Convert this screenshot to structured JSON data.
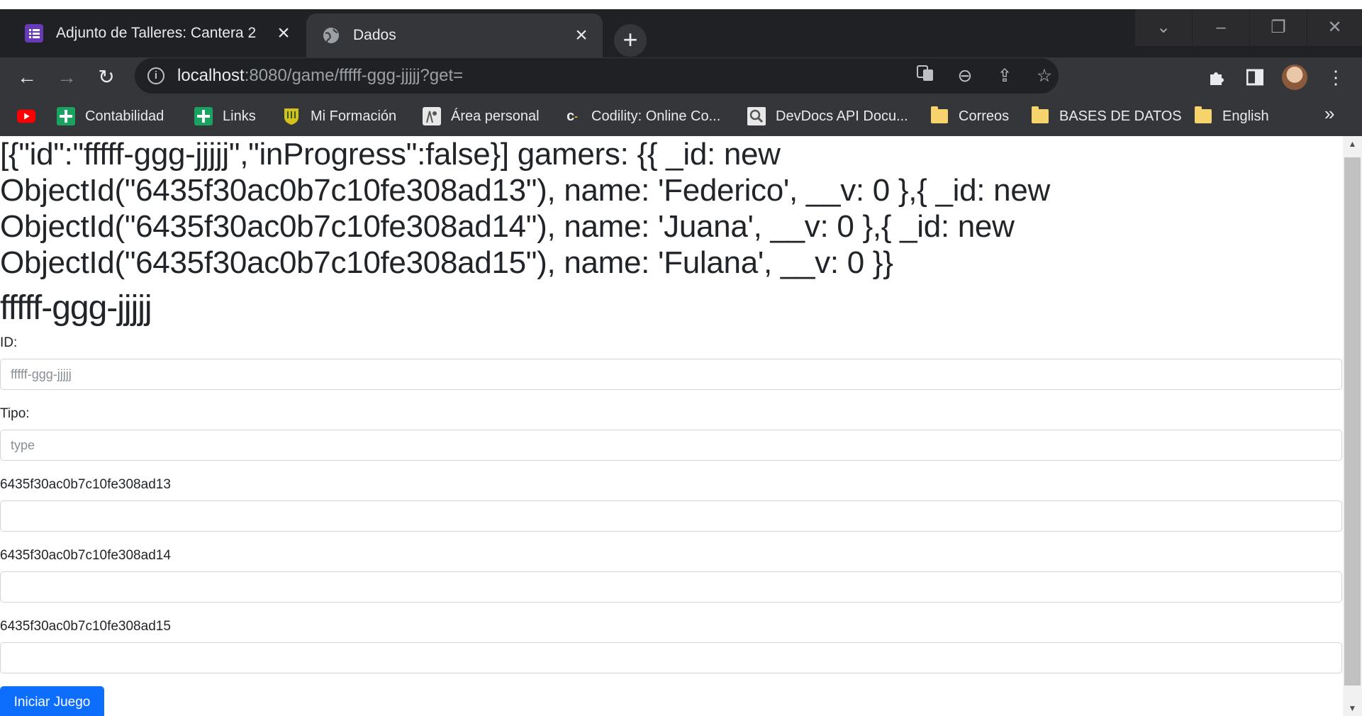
{
  "browser": {
    "tabs": [
      {
        "title": "Adjunto de Talleres: Cantera 2",
        "active": false,
        "icon": "list-icon",
        "color": "#673ab7"
      },
      {
        "title": "Dados",
        "active": true,
        "icon": "globe-icon"
      }
    ],
    "new_tab": "+",
    "address": {
      "host": "localhost",
      "rest": ":8080/game/fffff-ggg-jjjjj?get="
    },
    "bookmarks": [
      {
        "label": "",
        "icon": "youtube-icon"
      },
      {
        "label": "Contabilidad",
        "icon": "sheets-icon"
      },
      {
        "label": "Links",
        "icon": "sheets-icon"
      },
      {
        "label": "Mi Formación",
        "icon": "shield-icon"
      },
      {
        "label": "Área personal",
        "icon": "site-icon"
      },
      {
        "label": "Codility: Online Co...",
        "icon": "codility-icon"
      },
      {
        "label": "DevDocs API Docu...",
        "icon": "devdocs-icon"
      },
      {
        "label": "Correos",
        "icon": "folder-icon"
      },
      {
        "label": "BASES DE DATOS",
        "icon": "folder-icon"
      },
      {
        "label": "English",
        "icon": "folder-icon"
      }
    ],
    "bookmarks_more": "»"
  },
  "page": {
    "json_dump": "[{\"id\":\"fffff-ggg-jjjjj\",\"inProgress\":false}] gamers: {{ _id: new ObjectId(\"6435f30ac0b7c10fe308ad13\"), name: 'Federico', __v: 0 },{ _id: new ObjectId(\"6435f30ac0b7c10fe308ad14\"), name: 'Juana', __v: 0 },{ _id: new ObjectId(\"6435f30ac0b7c10fe308ad15\"), name: 'Fulana', __v: 0 }}",
    "game_id_heading": "fffff-ggg-jjjjj",
    "id_label": "ID:",
    "id_placeholder": "fffff-ggg-jjjjj",
    "type_label": "Tipo:",
    "type_placeholder": "type",
    "gamers": [
      {
        "label": "6435f30ac0b7c10fe308ad13",
        "value": ""
      },
      {
        "label": "6435f30ac0b7c10fe308ad14",
        "value": ""
      },
      {
        "label": "6435f30ac0b7c10fe308ad15",
        "value": ""
      }
    ],
    "start_button": "Iniciar Juego"
  },
  "colors": {
    "chrome_dark": "#202124",
    "chrome_toolbar": "#35363a",
    "primary": "#0d6efd"
  }
}
